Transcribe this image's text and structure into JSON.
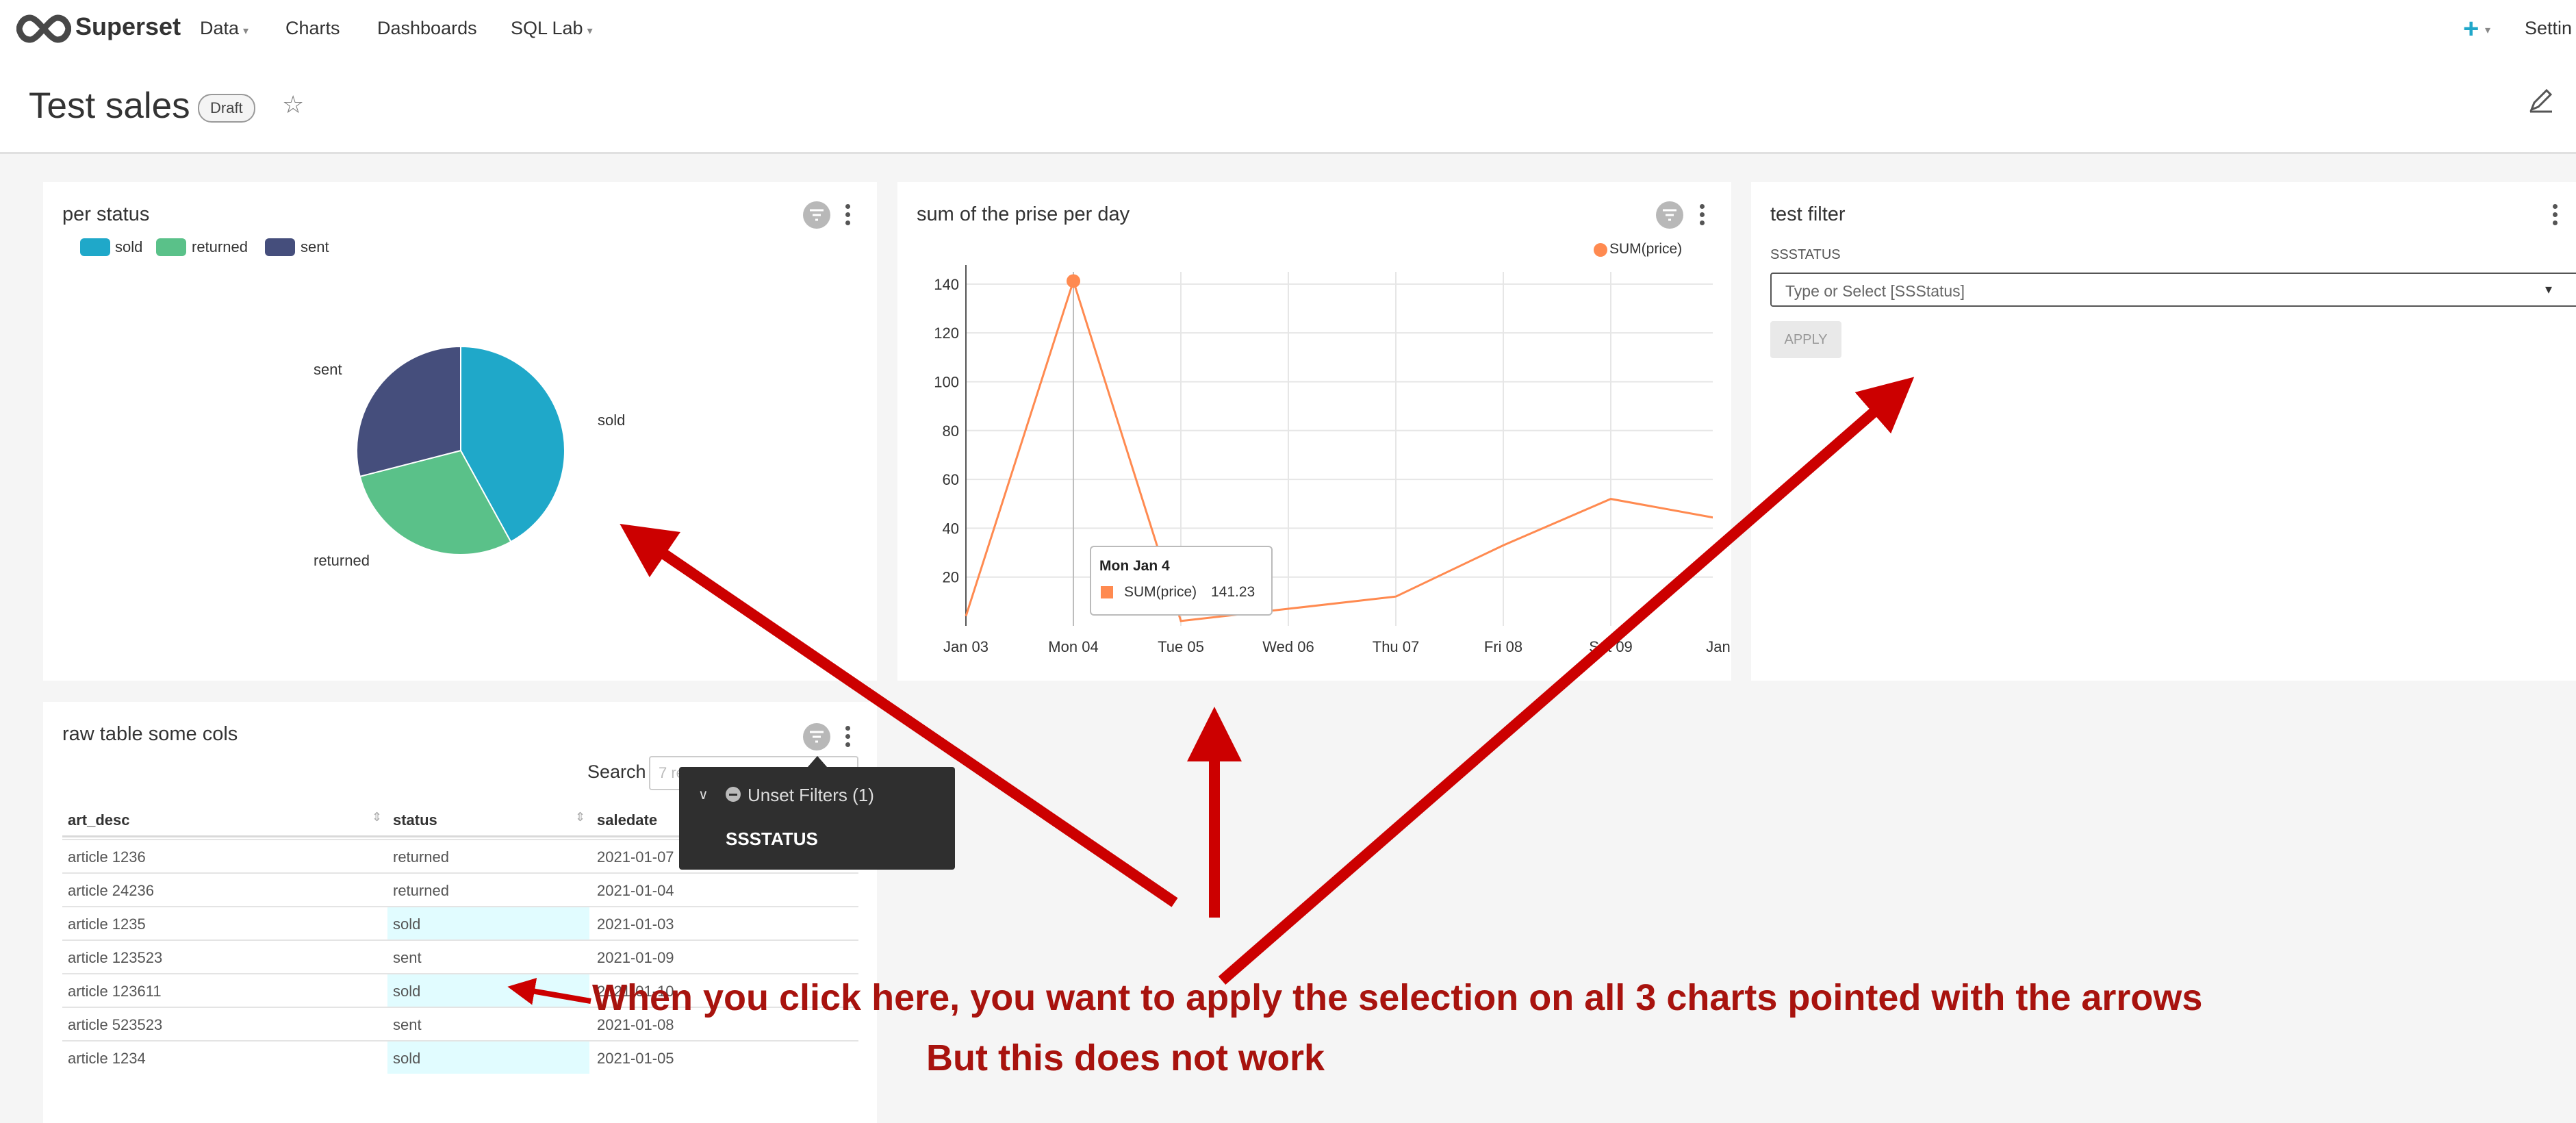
{
  "nav": {
    "brand": "Superset",
    "links": [
      {
        "label": "Data",
        "dropdown": true
      },
      {
        "label": "Charts",
        "dropdown": false
      },
      {
        "label": "Dashboards",
        "dropdown": false
      },
      {
        "label": "SQL Lab",
        "dropdown": true
      }
    ],
    "settings_label": "Settin",
    "accent_color": "#20a7c9"
  },
  "header": {
    "title": "Test sales",
    "badge": "Draft"
  },
  "panels": {
    "pie": {
      "title": "per status",
      "legend": [
        {
          "label": "sold",
          "color": "#1fa8c9"
        },
        {
          "label": "returned",
          "color": "#5ac189"
        },
        {
          "label": "sent",
          "color": "#454e7c"
        }
      ],
      "slice_labels": {
        "sold": "sold",
        "returned": "returned",
        "sent": "sent"
      }
    },
    "line": {
      "title": "sum of the prise per day",
      "legend": "SUM(price)",
      "tooltip": {
        "title": "Mon Jan 4",
        "series": "SUM(price)",
        "value": "141.23"
      }
    },
    "filter": {
      "title": "test filter",
      "field_label": "SSSTATUS",
      "placeholder": "Type or Select [SSStatus]",
      "apply_label": "APPLY"
    },
    "table": {
      "title": "raw table some cols",
      "search_label": "Search",
      "search_placeholder": "7 records",
      "columns": [
        "art_desc",
        "status",
        "saledate"
      ],
      "rows": [
        {
          "art_desc": "article 1236",
          "status": "returned",
          "saledate": "2021-01-07",
          "highlight": false
        },
        {
          "art_desc": "article 24236",
          "status": "returned",
          "saledate": "2021-01-04",
          "highlight": false
        },
        {
          "art_desc": "article 1235",
          "status": "sold",
          "saledate": "2021-01-03",
          "highlight": true
        },
        {
          "art_desc": "article 123523",
          "status": "sent",
          "saledate": "2021-01-09",
          "highlight": false
        },
        {
          "art_desc": "article 123611",
          "status": "sold",
          "saledate": "2021-01-10",
          "highlight": true
        },
        {
          "art_desc": "article 523523",
          "status": "sent",
          "saledate": "2021-01-08",
          "highlight": false
        },
        {
          "art_desc": "article 1234",
          "status": "sold",
          "saledate": "2021-01-05",
          "highlight": true
        }
      ]
    }
  },
  "filter_popover": {
    "header": "Unset Filters (1)",
    "item": "SSSTATUS"
  },
  "annotations": {
    "line1": "When you click here, you want to apply the selection on all 3 charts pointed with the arrows",
    "line2": "But this does not work"
  },
  "chart_data": [
    {
      "type": "pie",
      "title": "per status",
      "categories": [
        "sold",
        "returned",
        "sent"
      ],
      "values": [
        0.42,
        0.29,
        0.29
      ],
      "colors": [
        "#1fa8c9",
        "#5ac189",
        "#454e7c"
      ],
      "legend": "top-left"
    },
    {
      "type": "line",
      "title": "sum of the prise per day",
      "x": [
        "Jan 03",
        "Mon 04",
        "Tue 05",
        "Wed 06",
        "Thu 07",
        "Fri 08",
        "Sat 09",
        "Jan"
      ],
      "series": [
        {
          "name": "SUM(price)",
          "values": [
            4,
            141.23,
            2,
            7,
            12,
            33,
            52,
            44
          ],
          "color": "#ff8a50"
        }
      ],
      "ylim": [
        0,
        145
      ],
      "yticks": [
        20,
        40,
        60,
        80,
        100,
        120,
        140
      ],
      "grid": true,
      "legend": "top-right"
    }
  ]
}
